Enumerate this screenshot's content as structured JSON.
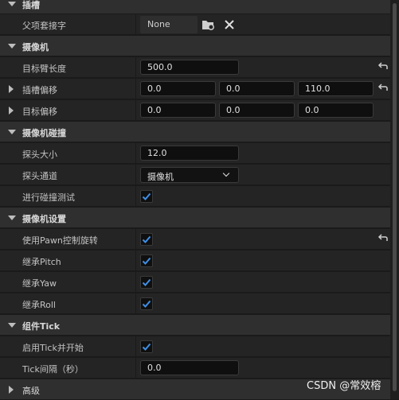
{
  "details": {
    "sections": {
      "socket": "插槽",
      "camera": "摄像机",
      "camera_collision": "摄像机碰撞",
      "camera_settings": "摄像机设置",
      "component_tick": "组件Tick",
      "advanced": "高级"
    },
    "properties": {
      "parent_socket": {
        "label": "父项套接字",
        "value": "None"
      },
      "target_arm_length": {
        "label": "目标臂长度",
        "value": "500.0"
      },
      "socket_offset": {
        "label": "插槽偏移",
        "x": "0.0",
        "y": "0.0",
        "z": "110.0"
      },
      "target_offset": {
        "label": "目标偏移",
        "x": "0.0",
        "y": "0.0",
        "z": "0.0"
      },
      "probe_size": {
        "label": "探头大小",
        "value": "12.0"
      },
      "probe_channel": {
        "label": "探头通道",
        "value": "摄像机"
      },
      "do_collision_test": {
        "label": "进行碰撞测试",
        "checked": true
      },
      "use_pawn_control_rotation": {
        "label": "使用Pawn控制旋转",
        "checked": true
      },
      "inherit_pitch": {
        "label": "继承Pitch",
        "checked": true
      },
      "inherit_yaw": {
        "label": "继承Yaw",
        "checked": true
      },
      "inherit_roll": {
        "label": "继承Roll",
        "checked": true
      },
      "start_with_tick_enabled": {
        "label": "启用Tick并开始",
        "checked": true
      },
      "tick_interval": {
        "label": "Tick间隔（秒）",
        "value": "0.0"
      }
    }
  },
  "watermark": "CSDN @常效榕",
  "colors": {
    "check": "#3f8fe6",
    "section_bg": "#2f2f2f",
    "row_bg": "#242424",
    "field_bg": "#0f0f0f"
  },
  "icons": [
    "chevron-down-icon",
    "chevron-right-icon",
    "browse-folder-icon",
    "clear-x-icon",
    "reset-arrow-icon",
    "checkmark-icon"
  ]
}
